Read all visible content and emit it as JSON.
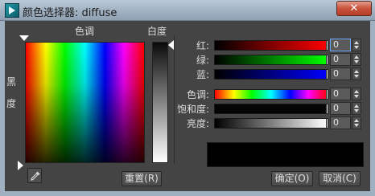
{
  "window": {
    "title": "颜色选择器: diffuse",
    "close_label": "✕"
  },
  "labels": {
    "hue": "色调",
    "whiteness": "白度",
    "blackness_1": "黑",
    "blackness_2": "度"
  },
  "channels": [
    {
      "label": "红:",
      "value": "0"
    },
    {
      "label": "绿:",
      "value": "0"
    },
    {
      "label": "蓝:",
      "value": "0"
    },
    {
      "label": "色调:",
      "value": "0"
    },
    {
      "label": "饱和度:",
      "value": "0"
    },
    {
      "label": "亮度:",
      "value": "0"
    }
  ],
  "buttons": {
    "reset": "重置(R)",
    "ok": "确定(O)",
    "cancel": "取消(C)"
  },
  "current_color": "#000000",
  "icons": {
    "app": "3dsmax-icon",
    "eyedropper": "eyedropper-icon"
  }
}
